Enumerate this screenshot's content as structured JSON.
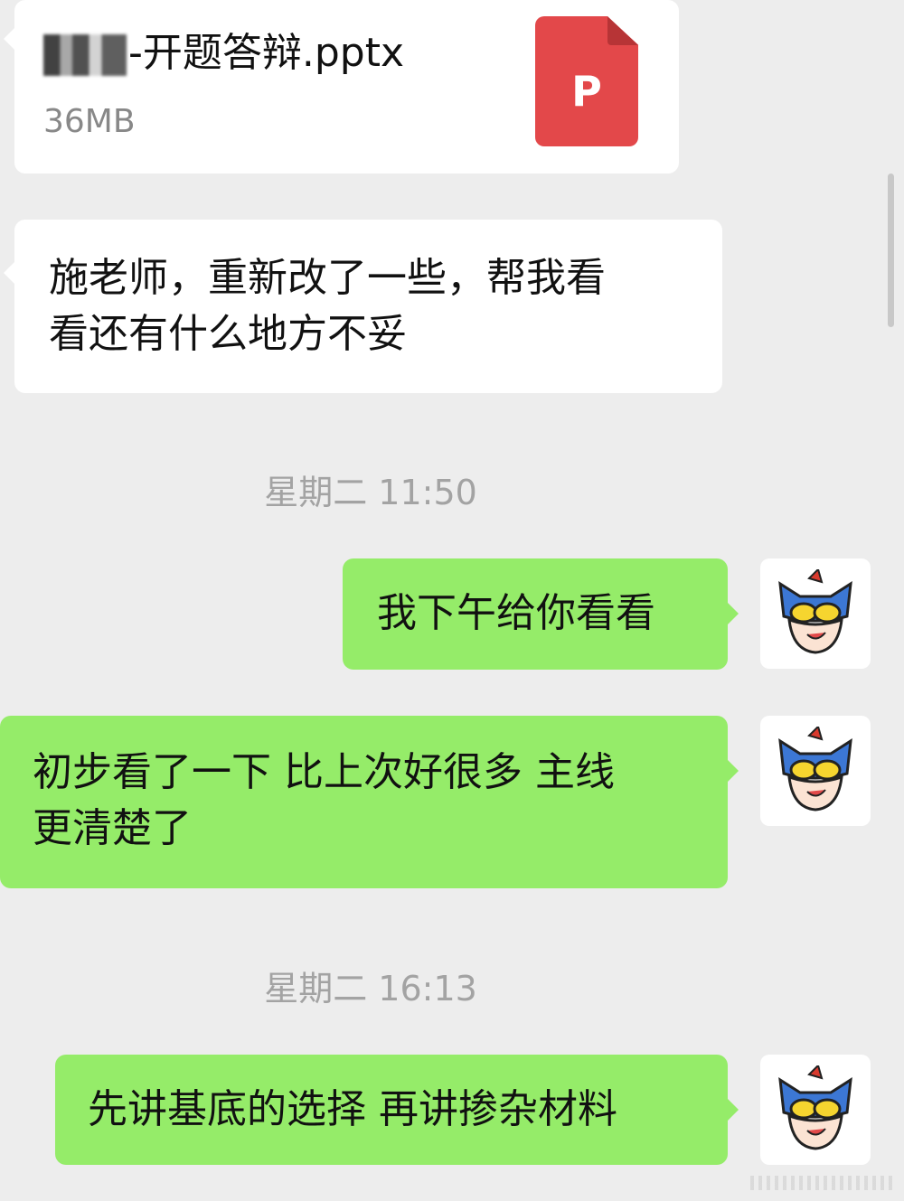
{
  "chat": {
    "file_message": {
      "file_name_visible": "-开题答辩.pptx",
      "file_size": "36MB",
      "file_type_letter": "P",
      "file_icon": "pptx-file-icon",
      "file_icon_color": "#e3484a"
    },
    "messages": [
      {
        "id": "msg1",
        "direction": "incoming",
        "lines": [
          "施老师，重新改了一些，帮我看",
          "看还有什么地方不妥"
        ]
      },
      {
        "id": "ts1",
        "type": "timestamp",
        "text": "星期二 11:50"
      },
      {
        "id": "msg2",
        "direction": "outgoing",
        "lines": [
          "我下午给你看看"
        ]
      },
      {
        "id": "msg3",
        "direction": "outgoing",
        "lines": [
          "初步看了一下 比上次好很多 主线",
          "更清楚了"
        ]
      },
      {
        "id": "ts2",
        "type": "timestamp",
        "text": "星期二 16:13"
      },
      {
        "id": "msg4",
        "direction": "outgoing",
        "lines": [
          "先讲基底的选择 再讲掺杂材料"
        ]
      }
    ],
    "colors": {
      "background": "#ededed",
      "incoming_bubble": "#ffffff",
      "outgoing_bubble": "#95ec69",
      "timestamp_text": "#a3a3a3"
    },
    "avatar_icon": "superhero-mask-avatar-icon"
  }
}
